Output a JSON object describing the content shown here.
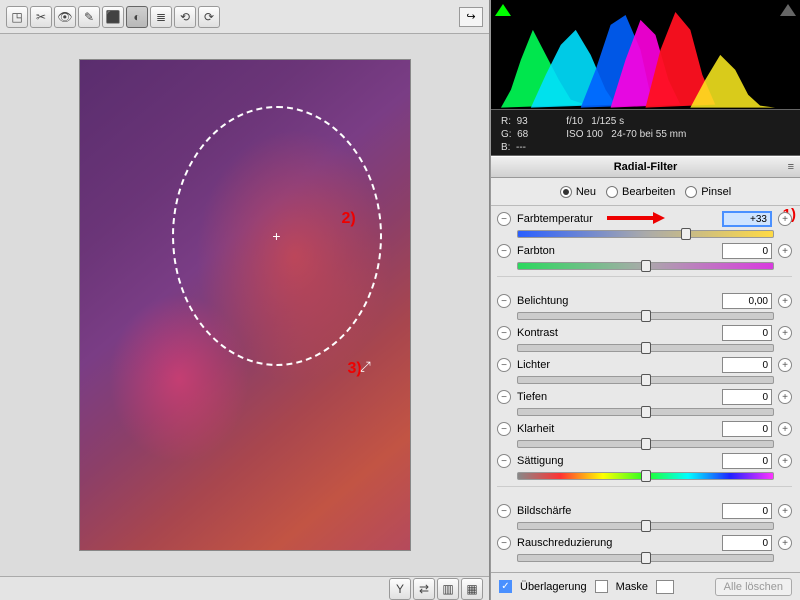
{
  "toolbar": {
    "tools": [
      "◳",
      "✂",
      "👁",
      "✎",
      "⬛",
      "◐",
      "≣",
      "⟲",
      "⟳"
    ]
  },
  "histogram": {
    "rgb": {
      "r_label": "R:",
      "g_label": "G:",
      "b_label": "B:",
      "r": "93",
      "g": "68",
      "b": "---"
    },
    "exposure": {
      "aperture": "f/10",
      "shutter": "1/125 s",
      "iso": "ISO 100",
      "lens": "24-70 bei 55 mm"
    }
  },
  "panel": {
    "title": "Radial-Filter"
  },
  "modes": {
    "neu": "Neu",
    "bearbeiten": "Bearbeiten",
    "pinsel": "Pinsel",
    "selected": "neu"
  },
  "annotations": {
    "a1": "1)",
    "a2": "2)",
    "a3": "3)"
  },
  "sliders": [
    {
      "key": "farbtemperatur",
      "label": "Farbtemperatur",
      "value": "+33",
      "pos": 66,
      "track": "temp",
      "active": true,
      "arrow": true
    },
    {
      "key": "farbton",
      "label": "Farbton",
      "value": "0",
      "pos": 50,
      "track": "tint"
    },
    {
      "gap": true
    },
    {
      "key": "belichtung",
      "label": "Belichtung",
      "value": "0,00",
      "pos": 50
    },
    {
      "key": "kontrast",
      "label": "Kontrast",
      "value": "0",
      "pos": 50
    },
    {
      "key": "lichter",
      "label": "Lichter",
      "value": "0",
      "pos": 50
    },
    {
      "key": "tiefen",
      "label": "Tiefen",
      "value": "0",
      "pos": 50
    },
    {
      "key": "klarheit",
      "label": "Klarheit",
      "value": "0",
      "pos": 50
    },
    {
      "key": "saettigung",
      "label": "Sättigung",
      "value": "0",
      "pos": 50,
      "track": "sat"
    },
    {
      "gap": true
    },
    {
      "key": "bildschaerfe",
      "label": "Bildschärfe",
      "value": "0",
      "pos": 50
    },
    {
      "key": "rauschreduzierung",
      "label": "Rauschreduzierung",
      "value": "0",
      "pos": 50
    }
  ],
  "bottom": {
    "overlay": "Überlagerung",
    "mask": "Maske",
    "clear": "Alle löschen"
  }
}
